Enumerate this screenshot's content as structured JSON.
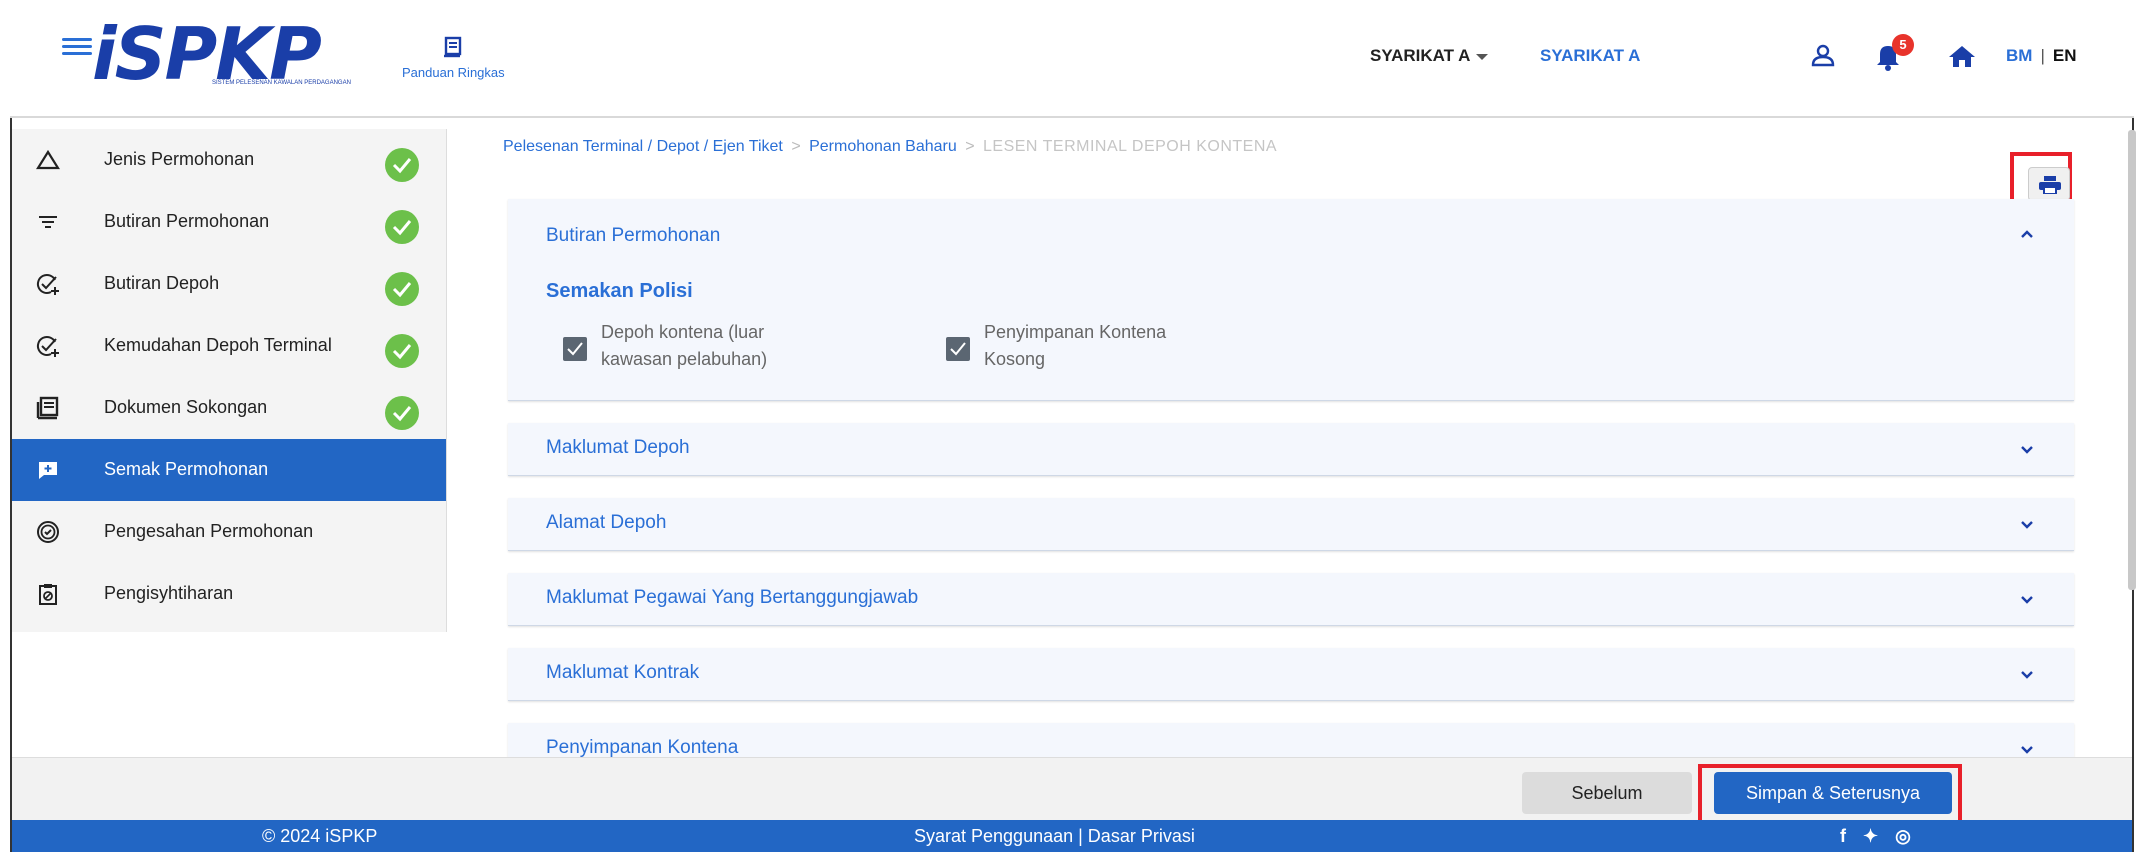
{
  "header": {
    "logo_text": "iSPKP",
    "logo_subtitle": "SISTEM PELESENAN KAWALAN PERDAGANGAN",
    "guide_label": "Panduan Ringkas",
    "company_dropdown": "SYARIKAT A",
    "company_active": "SYARIKAT A",
    "notification_count": "5",
    "lang_bm": "BM",
    "lang_sep": "|",
    "lang_en": "EN"
  },
  "sidebar": {
    "items": [
      {
        "label": "Jenis Permohonan",
        "icon": "triangle-icon",
        "done": true
      },
      {
        "label": "Butiran Permohonan",
        "icon": "filter-lines-icon",
        "done": true
      },
      {
        "label": "Butiran Depoh",
        "icon": "check-plus-icon",
        "done": true
      },
      {
        "label": "Kemudahan Depoh Terminal",
        "icon": "check-plus-icon",
        "done": true
      },
      {
        "label": "Dokumen Sokongan",
        "icon": "document-list-icon",
        "done": true
      },
      {
        "label": "Semak Permohonan",
        "icon": "review-chat-icon",
        "active": true
      },
      {
        "label": "Pengesahan Permohonan",
        "icon": "verified-badge-icon"
      },
      {
        "label": "Pengisyhtiharan",
        "icon": "clipboard-icon"
      }
    ]
  },
  "breadcrumb": {
    "items": [
      "Pelesenan Terminal / Depot / Ejen Tiket",
      "Permohonan Baharu"
    ],
    "sep": ">",
    "current": "LESEN TERMINAL DEPOH KONTENA"
  },
  "sections": {
    "butiran": {
      "title": "Butiran Permohonan",
      "subhead": "Semakan Polisi",
      "checkbox1_line1": "Depoh kontena (luar",
      "checkbox1_line2": "kawasan pelabuhan)",
      "checkbox2_line1": "Penyimpanan Kontena",
      "checkbox2_line2": "Kosong"
    },
    "maklumat_depoh": "Maklumat Depoh",
    "alamat_depoh": "Alamat Depoh",
    "maklumat_pegawai": "Maklumat Pegawai Yang Bertanggungjawab",
    "maklumat_kontrak": "Maklumat Kontrak",
    "penyimpanan_kontena": "Penyimpanan Kontena"
  },
  "actions": {
    "previous": "Sebelum",
    "save_next": "Simpan & Seterusnya"
  },
  "footer": {
    "copyright": "© 2024 iSPKP",
    "links": "Syarat Penggunaan | Dasar Privasi",
    "social": "f ✦ ◎"
  },
  "colors": {
    "primary": "#2266c4",
    "link": "#2a6fd6",
    "success": "#6cc04a",
    "highlight": "#e8202a"
  }
}
